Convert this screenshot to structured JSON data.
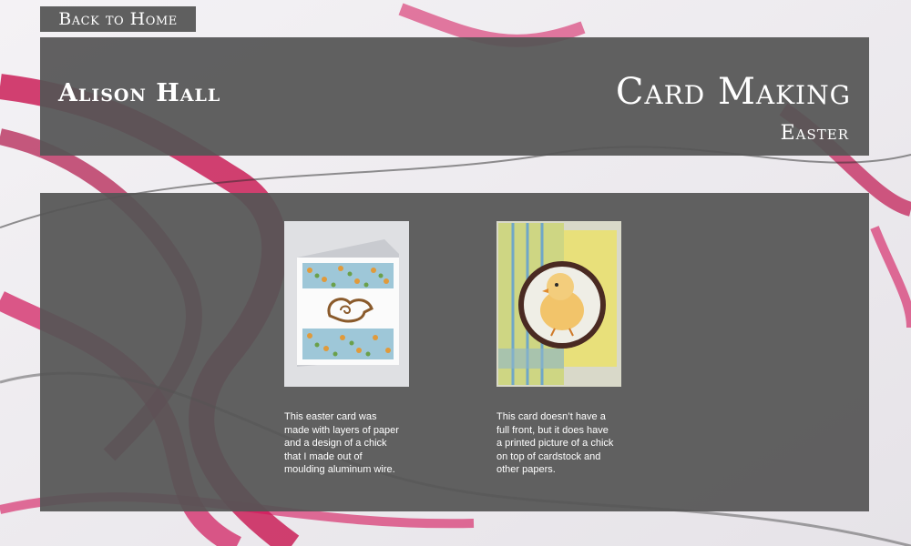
{
  "nav": {
    "back_label": "Back to Home"
  },
  "header": {
    "author": "Alison Hall",
    "title": "Card Making",
    "subtitle": "Easter"
  },
  "cards": [
    {
      "photo": "chick-wire-card-photo",
      "caption": "This easter card was made with layers of paper and a design of a chick that I made out of moulding aluminum wire."
    },
    {
      "photo": "printed-chick-card-photo",
      "caption": "This card doesn’t have a full front, but it does have a printed picture of a chick on top of cardstock and other papers."
    }
  ],
  "colors": {
    "panel": "#555555",
    "accent": "#d4145a"
  }
}
